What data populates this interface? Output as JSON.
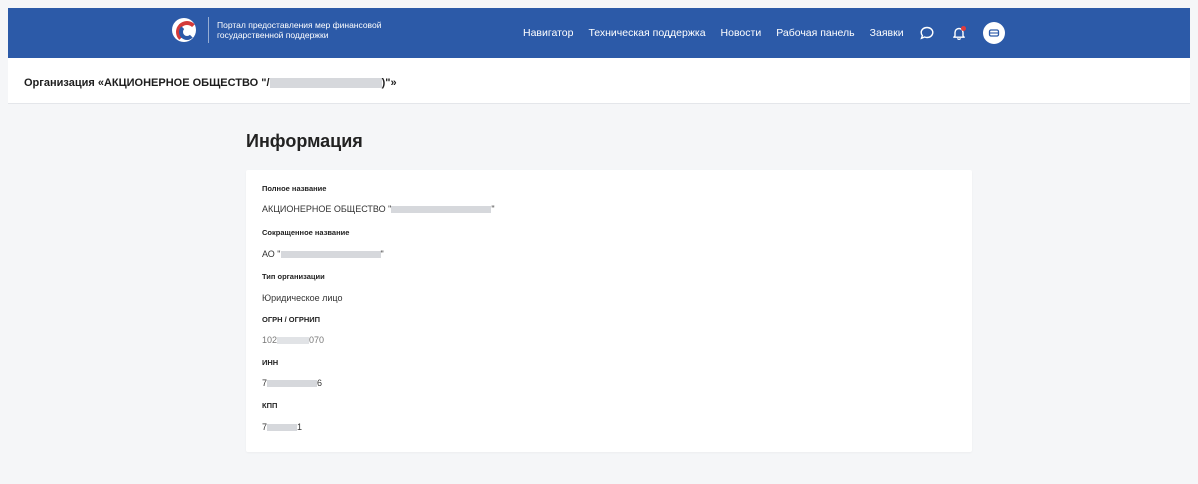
{
  "header": {
    "brand_line1": "Портал предоставления мер финансовой",
    "brand_line2": "государственной поддержки",
    "nav": [
      "Навигатор",
      "Техническая поддержка",
      "Новости",
      "Рабочая панель",
      "Заявки"
    ],
    "icons": [
      "chat-icon",
      "bell-icon",
      "user-avatar-icon"
    ],
    "accent": "#2c5aa8",
    "badge_color": "#e03b3b"
  },
  "org": {
    "title_prefix": "Организация «АКЦИОНЕРНОЕ ОБЩЕСТВО \"/",
    "title_suffix": ")\"»"
  },
  "info": {
    "title": "Информация",
    "fields": [
      {
        "label": "Полное название",
        "value_prefix": "АКЦИОНЕРНОЕ ОБЩЕСТВО \"",
        "value_suffix": "\""
      },
      {
        "label": "Сокращенное название",
        "value_prefix": "АО \"",
        "value_suffix": "\""
      },
      {
        "label": "Тип организации",
        "value_prefix": "Юридическое лицо",
        "value_suffix": ""
      },
      {
        "label": "ОГРН / ОГРНИП",
        "value_prefix": "102",
        "value_suffix": "070"
      },
      {
        "label": "ИНН",
        "value_prefix": "7",
        "value_suffix": "6"
      },
      {
        "label": "КПП",
        "value_prefix": "7",
        "value_suffix": "1"
      }
    ]
  }
}
